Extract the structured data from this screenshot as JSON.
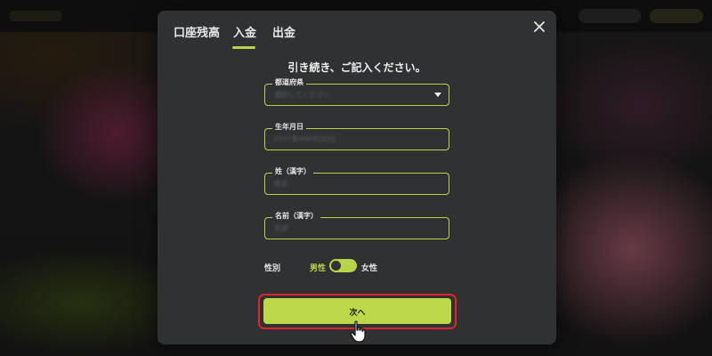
{
  "tabs": [
    {
      "label": "口座残高"
    },
    {
      "label": "入金"
    },
    {
      "label": "出金"
    }
  ],
  "active_tab": "入金",
  "heading": "引き続き、ご記入ください。",
  "fields": {
    "prefecture": {
      "label": "都道府県",
      "value": "選択してください"
    },
    "birthdate": {
      "label": "生年月日",
      "value": "YYYY年MM月DD日"
    },
    "last_name": {
      "label": "姓（漢字）",
      "value": "姓名"
    },
    "first_name": {
      "label": "名前（漢字）",
      "value": "名前"
    }
  },
  "gender": {
    "label": "性別",
    "male": "男性",
    "female": "女性",
    "selected": "男性"
  },
  "next_button": {
    "label": "次へ"
  },
  "colors": {
    "accent": "#b8d44a",
    "highlight": "#e0242c",
    "modal_bg": "#303133"
  },
  "icons": {
    "close": "close-icon",
    "dropdown": "chevron-down-icon",
    "cursor": "hand-pointer-icon"
  }
}
